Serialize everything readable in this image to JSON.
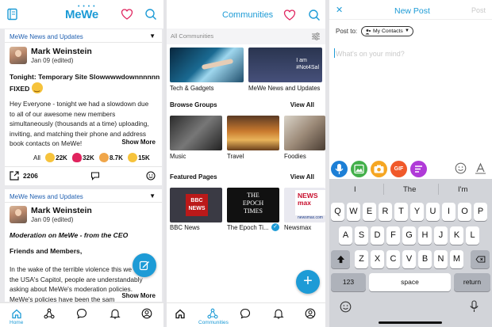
{
  "feed": {
    "logo": "MeWe",
    "posts": [
      {
        "group": "MeWe News and Updates",
        "author": "Mark Weinstein",
        "date": "Jan 09 (edited)",
        "title": "Tonight: Temporary Site Slowwwwdownnnnnn FIXED",
        "body": "Hey Everyone - tonight we had a slowdown due\nto all of our awesome new members\nsimultaneously (thousands at a time) uploading,\ninviting, and matching their phone and address\nbook contacts on MeWe!",
        "show_more": "Show More",
        "reactions_all": "All",
        "reactions": [
          {
            "icon": "clap-icon",
            "count": "22K",
            "color": "#f6c33c"
          },
          {
            "icon": "heart-icon",
            "count": "32K",
            "color": "#e0245e"
          },
          {
            "icon": "pray-icon",
            "count": "8.7K",
            "color": "#f0a64a"
          },
          {
            "icon": "thumbsup-icon",
            "count": "15K",
            "color": "#f6c33c"
          }
        ],
        "share_count": "2206"
      },
      {
        "group": "MeWe News and Updates",
        "author": "Mark Weinstein",
        "date": "Jan 09 (edited)",
        "title": "Moderation on MeWe - from the CEO",
        "greeting": "Friends and Members,",
        "body": "In the wake of the terrible violence this we\nthe USA's Capitol, people are understandably\nasking about MeWe's moderation policies.\nMeWe's policies have been the sam",
        "show_more": "Show More"
      }
    ],
    "tabbar": {
      "home_label": "Home"
    }
  },
  "communities": {
    "title": "Communities",
    "filter_label": "All Communities",
    "top_groups": [
      {
        "label": "Tech & Gadgets"
      },
      {
        "label": "MeWe News and Updates",
        "overlay": "I am\n#Not4Sal"
      }
    ],
    "browse": {
      "heading": "Browse Groups",
      "view_all": "View All",
      "items": [
        "Music",
        "Travel",
        "Foodies"
      ]
    },
    "featured": {
      "heading": "Featured Pages",
      "view_all": "View All",
      "items": [
        {
          "label": "BBC News",
          "logo": "BBC\nNEWS"
        },
        {
          "label": "The Epoch Ti...",
          "logo": "THE\nEPOCH\nTIMES"
        },
        {
          "label": "Newsmax",
          "logo": "NEWS\nmax",
          "sub": "newsmax.com"
        }
      ]
    },
    "tabbar": {
      "label": "Communities"
    }
  },
  "new_post": {
    "title": "New Post",
    "post_button": "Post",
    "post_to_label": "Post to:",
    "audience": "My Contacts",
    "placeholder": "What's on your mind?",
    "toolbar": [
      {
        "icon": "microphone-icon",
        "color": "#1d7fd6"
      },
      {
        "icon": "image-icon",
        "color": "#43b04a"
      },
      {
        "icon": "camera-icon",
        "color": "#f5a623"
      },
      {
        "icon": "gif-icon",
        "color": "#f0592a",
        "text": "GIF"
      },
      {
        "icon": "poll-icon",
        "color": "#b03ad8"
      }
    ],
    "keyboard": {
      "suggestions": [
        "I",
        "The",
        "I'm"
      ],
      "row1": [
        "Q",
        "W",
        "E",
        "R",
        "T",
        "Y",
        "U",
        "I",
        "O",
        "P"
      ],
      "row2": [
        "A",
        "S",
        "D",
        "F",
        "G",
        "H",
        "J",
        "K",
        "L"
      ],
      "row3": [
        "Z",
        "X",
        "C",
        "V",
        "B",
        "N",
        "M"
      ],
      "numbers": "123",
      "space": "space",
      "return": "return"
    }
  }
}
